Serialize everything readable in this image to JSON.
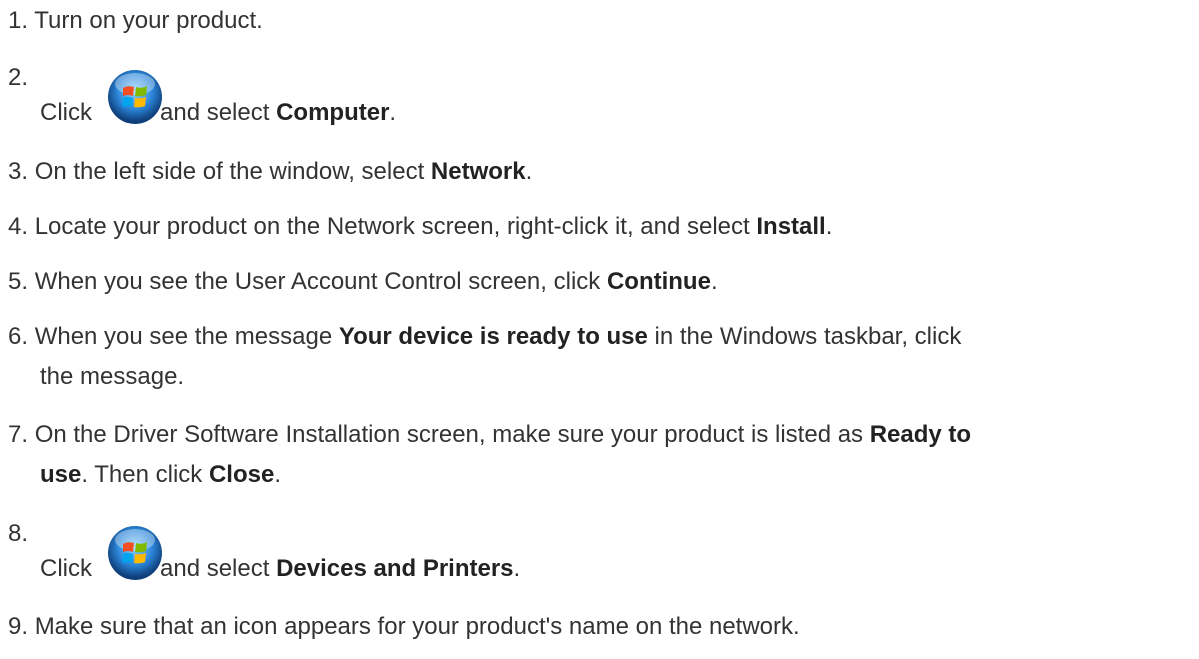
{
  "steps": [
    {
      "num": "1.",
      "parts": [
        "Turn on your product."
      ]
    },
    {
      "num": "2.",
      "click": "Click",
      "after": "and select ",
      "bold": "Computer",
      "end": "."
    },
    {
      "num": "3.",
      "parts": [
        "On the left side of the window, select ",
        "Network",
        "."
      ]
    },
    {
      "num": "4.",
      "parts": [
        "Locate your product on the Network screen, right-click it, and select ",
        "Install",
        "."
      ]
    },
    {
      "num": "5.",
      "parts": [
        "When you see the User Account Control screen, click ",
        "Continue",
        "."
      ]
    },
    {
      "num": "6.",
      "parts": [
        "When you see the message ",
        "Your device is ready to use",
        " in the Windows taskbar, click"
      ],
      "line2": "the message."
    },
    {
      "num": "7.",
      "parts": [
        "On the Driver Software Installation screen, make sure your product is listed as ",
        "Ready to"
      ],
      "line2_bold": "use",
      "line2_mid": ". Then click ",
      "line2_bold2": "Close",
      "line2_end": "."
    },
    {
      "num": "8.",
      "click": "Click",
      "after": "and select ",
      "bold": "Devices and Printers",
      "end": "."
    },
    {
      "num": "9.",
      "parts": [
        "Make sure that an icon appears for your product's name on the network."
      ]
    }
  ],
  "icons": {
    "start_button": "windows-start-orb-icon"
  }
}
